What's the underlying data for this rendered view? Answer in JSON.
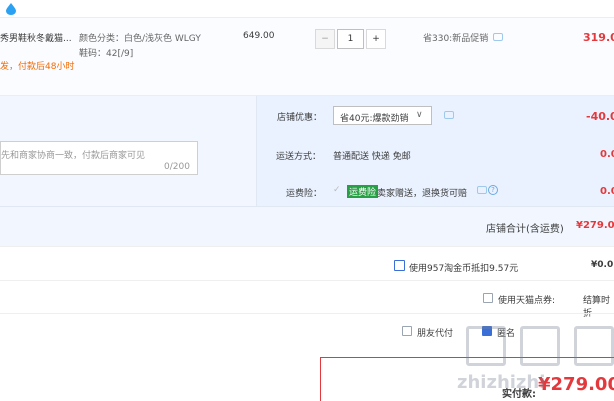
{
  "item": {
    "title": "秀男鞋秋冬戴猫...",
    "color_prop": "颜色分类：白色/浅灰色 WLGY",
    "size_prop": "鞋码：42[/9]",
    "ship_note": "发，付款后48小时",
    "unit_price": "649.00",
    "quantity": "1",
    "minus_label": "−",
    "plus_label": "+",
    "promo": "省330:新品促销",
    "subtotal": "319.0"
  },
  "shop": {
    "discount_label": "店铺优惠：",
    "discount_select": "省40元:爆款劲销",
    "discount_value": "-40.0",
    "message_placeholder": "先和商家协商一致，付款后商家可见",
    "message_counter": "0/200",
    "shipping_label": "运送方式：",
    "shipping_value": "普通配送 快递 免邮",
    "shipping_fee": "0.0",
    "insurance_label": "运费险：",
    "insurance_badge": "运费险",
    "insurance_text": "卖家赠送，退换货可赔",
    "insurance_fee": "0.0",
    "total_label": "店铺合计(含运费)",
    "total_value": "¥279.0"
  },
  "options": {
    "coins_text": "使用957淘金币抵扣9.57元",
    "coins_value": "¥0.0",
    "tmall_points_text": "使用天猫点券:",
    "tmall_points_value": "结算时折",
    "friend_pay": "朋友代付",
    "anon": "匿名"
  },
  "payment": {
    "label": "实付款:",
    "amount": "¥279.00"
  },
  "watermark": {
    "text": "zhizhizhi"
  },
  "colors": {
    "accent_red": "#e4393c",
    "orange": "#f56a00",
    "blue_band": "#eaf2ff",
    "insurance_green": "#27a045"
  }
}
